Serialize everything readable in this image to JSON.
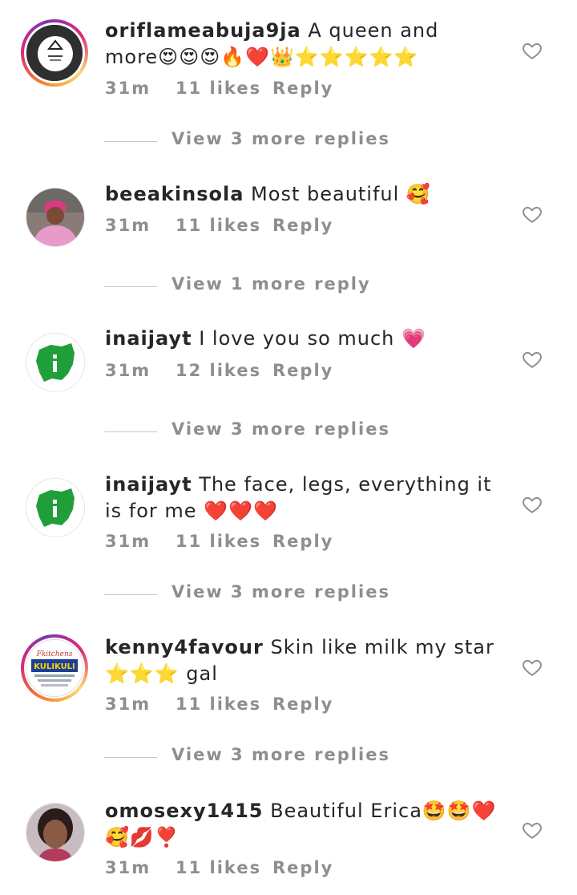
{
  "comments": [
    {
      "username": "oriflameabuja9ja",
      "text": "A queen and more😍😍😍🔥❤️👑⭐⭐⭐⭐⭐",
      "time": "31m",
      "likes": "11 likes",
      "reply": "Reply",
      "view_replies": "View 3 more replies"
    },
    {
      "username": "beeakinsola",
      "text": "Most beautiful 🥰",
      "time": "31m",
      "likes": "11 likes",
      "reply": "Reply",
      "view_replies": "View 1 more reply"
    },
    {
      "username": "inaijayt",
      "text": "I love you so much 💗",
      "time": "31m",
      "likes": "12 likes",
      "reply": "Reply",
      "view_replies": "View 3 more replies"
    },
    {
      "username": "inaijayt",
      "text": "The face, legs, everything it is for me ❤️❤️❤️",
      "time": "31m",
      "likes": "11 likes",
      "reply": "Reply",
      "view_replies": "View 3 more replies"
    },
    {
      "username": "kenny4favour",
      "text": "Skin like milk my star ⭐⭐⭐ gal",
      "time": "31m",
      "likes": "11 likes",
      "reply": "Reply",
      "view_replies": "View 3 more replies"
    },
    {
      "username": "omosexy1415",
      "text": "Beautiful Erica🤩🤩❤️🥰💋❣️",
      "time": "31m",
      "likes": "11 likes",
      "reply": "Reply"
    }
  ],
  "avatars": {
    "c5_brand": "Fkitchens",
    "c5_name": "KULIKULI"
  },
  "colors": {
    "text": "#262626",
    "meta": "#8e8e8e",
    "nigeria_green": "#1f9e3a"
  }
}
